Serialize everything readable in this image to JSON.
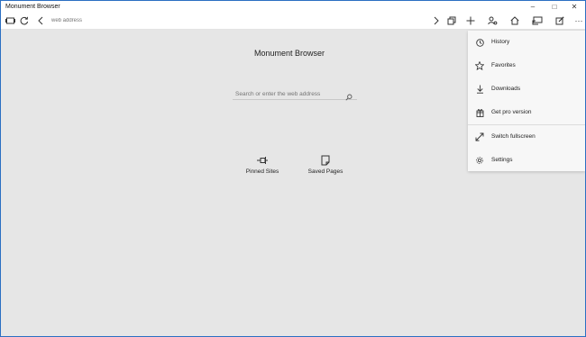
{
  "window": {
    "title": "Monument Browser",
    "accent_color": "#2b6fc2"
  },
  "toolbar": {
    "address_placeholder": "web address",
    "icons": [
      "tabs-icon",
      "refresh-icon",
      "back-icon",
      "forward-icon",
      "duplicate-tab-icon",
      "add-icon",
      "user-settings-icon",
      "home-icon",
      "reading-view-icon",
      "edit-icon",
      "more-icon"
    ]
  },
  "main": {
    "title": "Monument Browser",
    "search_placeholder": "Search or enter the web address",
    "quick_links": [
      {
        "label": "Pinned Sites",
        "icon": "pin-icon"
      },
      {
        "label": "Saved Pages",
        "icon": "saved-page-icon"
      }
    ]
  },
  "menu": {
    "items": [
      {
        "label": "History",
        "icon": "clock-icon"
      },
      {
        "label": "Favorites",
        "icon": "star-icon"
      },
      {
        "label": "Downloads",
        "icon": "download-icon"
      },
      {
        "label": "Get pro version",
        "icon": "gift-icon"
      },
      {
        "label": "Switch fullscreen",
        "icon": "fullscreen-icon"
      },
      {
        "label": "Settings",
        "icon": "gear-icon"
      }
    ]
  }
}
